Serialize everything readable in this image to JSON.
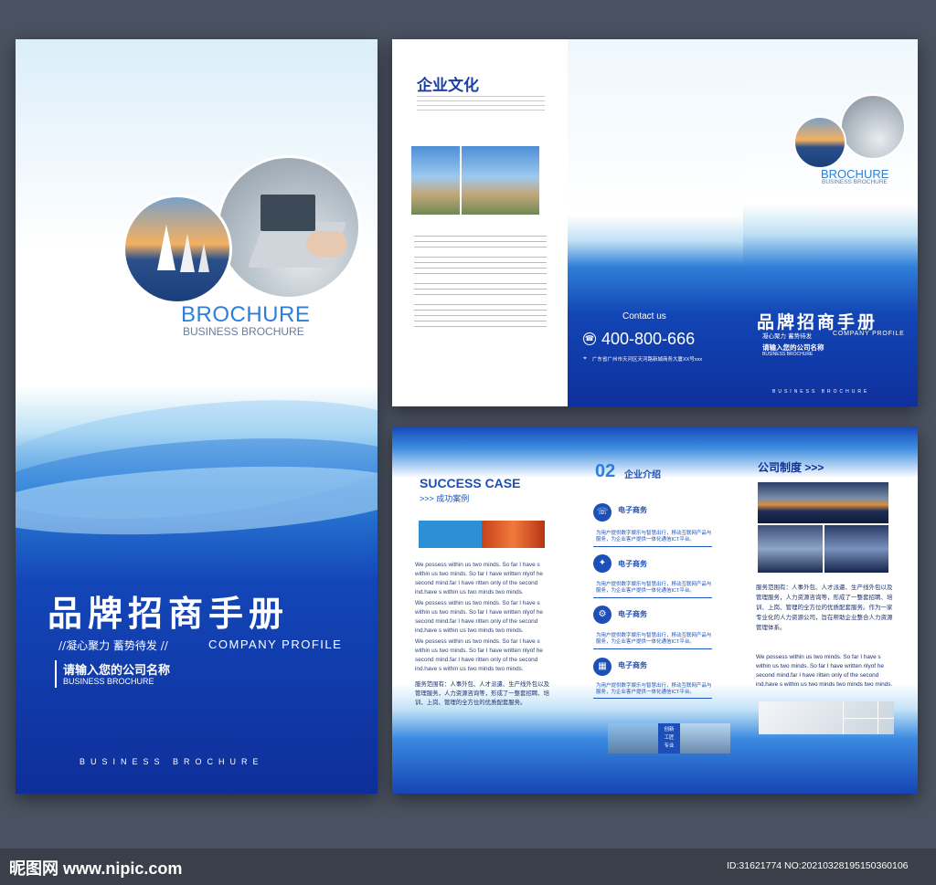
{
  "cover": {
    "brochure_title": "BROCHURE",
    "brochure_subtitle": "BUSINESS BROCHURE",
    "main_title": "品牌招商手册",
    "slogan": "//凝心聚力 蓄势待发 //",
    "company_profile": "COMPANY PROFILE",
    "company_name": "请输入您的公司名称",
    "company_name_en": "BUSINESS BROCHURE",
    "footer": "BUSINESS BROCHURE"
  },
  "outer_spread": {
    "culture_title": "企业文化",
    "contact_label": "Contact us",
    "phone": "400-800-666",
    "address": "广东省广州市天河区天河路新城商务大厦XX号xxx",
    "brochure_title": "BROCHURE",
    "brochure_subtitle": "BUSINESS BROCHURE",
    "main_title": "品牌招商手册",
    "slogan": "凝心聚力 蓄势待发",
    "company_profile": "COMPANY PROFILE",
    "company_name": "请输入您的公司名称",
    "company_name_en": "BUSINESS BROCHURE",
    "footer": "BUSINESS BROCHURE"
  },
  "inner_spread": {
    "success_title": "SUCCESS CASE",
    "success_subtitle": ">>> 成功案例",
    "success_para1": "We possess within us two minds. So far I have s within us two minds. So far I have written nlyof he second mind.far I have ritten only of the second ind.have s within us two minds two minds.",
    "success_para2": "We possess within us two minds. So far I have s within us two minds. So far I have written nlyof he second mind.far I have ritten only of the second ind.have s within us two minds two minds.",
    "success_para3": "We possess within us two minds. So far I have s within us two minds. So far I have written nlyof he second mind.far I have ritten only of the second ind.have s within us two minds two minds.",
    "service_para": "服务范围有：人事外包、人才派遣、生产线外包以及管理服务，人力资源咨询等，形成了一整套招聘、培训、上岗、管理的全方位的优质配套服务。",
    "intro_number": "02",
    "intro_title": "企业介绍",
    "intro_items": [
      {
        "title": "电子商务",
        "icon": "phone-icon"
      },
      {
        "title": "电子商务",
        "icon": "lightbulb-icon"
      },
      {
        "title": "电子商务",
        "icon": "gear-icon"
      },
      {
        "title": "电子商务",
        "icon": "chart-icon"
      }
    ],
    "intro_item_text": "为用户提供数字娱乐与智慧出行，移动互联网产品与服务，为企业客户提供一体化通信ICT平台。",
    "badge_lines": [
      "创新",
      "工匠",
      "专业"
    ],
    "policy_title": "公司制度 >>>",
    "policy_para_cn": "服务范围有：人事外包、人才派遣、生产线外包以及管理服务，人力资源咨询等，形成了一整套招聘、培训、上岗、管理的全方位的优质配套服务。作为一家专业化的人力资源公司，旨在帮助企业整合人力资源管理体系。",
    "policy_para_en": "We possess within us two minds. So far I have s within us two minds. So far I have written nlyof he second mind.far I have ritten only of the second ind.have s within us two minds two minds two minds."
  },
  "watermark": {
    "logo": "昵图网 www.nipic.com",
    "id": "ID:31621774 NO:20210328195150360106"
  },
  "colors": {
    "brand_blue": "#1346b8",
    "dark_blue": "#0e2f9a",
    "background": "#4a5160"
  }
}
